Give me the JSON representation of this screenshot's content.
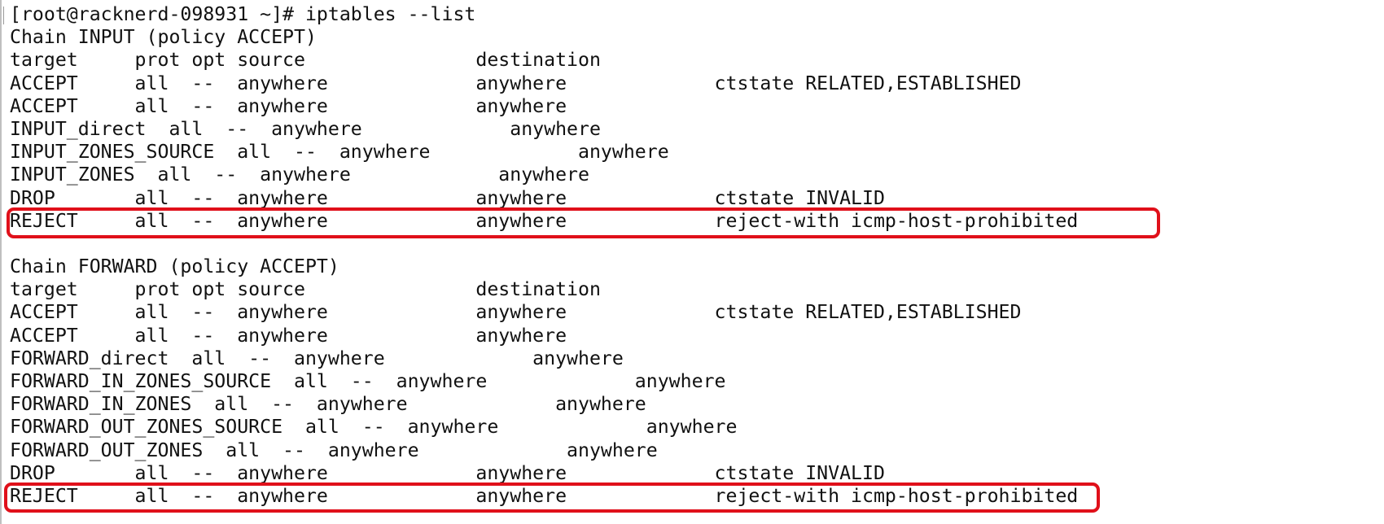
{
  "terminal": {
    "prompt": "[root@racknerd-098931 ~]# iptables --list",
    "input_chain": {
      "header": "Chain INPUT (policy ACCEPT)",
      "columns": "target     prot opt source               destination",
      "rules": [
        "ACCEPT     all  --  anywhere             anywhere             ctstate RELATED,ESTABLISHED",
        "ACCEPT     all  --  anywhere             anywhere",
        "INPUT_direct  all  --  anywhere             anywhere",
        "INPUT_ZONES_SOURCE  all  --  anywhere             anywhere",
        "INPUT_ZONES  all  --  anywhere             anywhere",
        "DROP       all  --  anywhere             anywhere             ctstate INVALID",
        "REJECT     all  --  anywhere             anywhere             reject-with icmp-host-prohibited"
      ]
    },
    "forward_chain": {
      "header": "Chain FORWARD (policy ACCEPT)",
      "columns": "target     prot opt source               destination",
      "rules": [
        "ACCEPT     all  --  anywhere             anywhere             ctstate RELATED,ESTABLISHED",
        "ACCEPT     all  --  anywhere             anywhere",
        "FORWARD_direct  all  --  anywhere             anywhere",
        "FORWARD_IN_ZONES_SOURCE  all  --  anywhere             anywhere",
        "FORWARD_IN_ZONES  all  --  anywhere             anywhere",
        "FORWARD_OUT_ZONES_SOURCE  all  --  anywhere             anywhere",
        "FORWARD_OUT_ZONES  all  --  anywhere             anywhere",
        "DROP       all  --  anywhere             anywhere             ctstate INVALID",
        "REJECT     all  --  anywhere             anywhere             reject-with icmp-host-prohibited"
      ]
    }
  },
  "colors": {
    "text": "#111111",
    "background": "#ffffff",
    "highlight": "#e0101a"
  }
}
